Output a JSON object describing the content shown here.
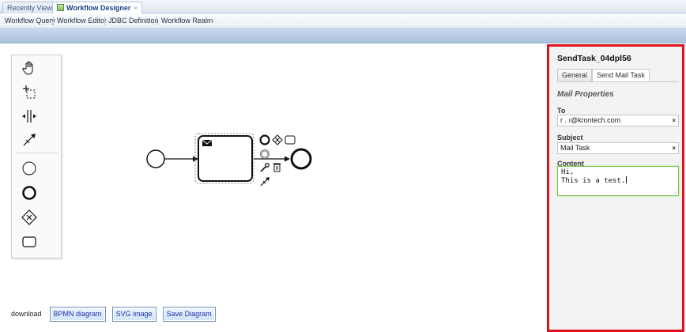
{
  "tabs": [
    {
      "label": "Recently View",
      "active": false
    },
    {
      "label": "Workflow Designer",
      "active": true,
      "close": "×"
    }
  ],
  "menu": [
    "Workflow Query",
    "Workflow Editor",
    "JDBC Definition",
    "Workflow Realm"
  ],
  "palette": {
    "tools": [
      "hand-tool",
      "lasso-tool",
      "space-tool",
      "global-connect-tool",
      "start-event",
      "end-event",
      "gateway",
      "task"
    ]
  },
  "diagram": {
    "elements": [
      "start-event",
      "send-task",
      "end-event"
    ],
    "context_pad": [
      "end-event",
      "gateway",
      "task",
      "intermediate-event",
      "wrench",
      "delete",
      "connect"
    ]
  },
  "download": {
    "label": "download",
    "buttons": [
      "BPMN diagram",
      "SVG image",
      "Save Diagram"
    ]
  },
  "properties": {
    "title": "SendTask_04dpl56",
    "tabs": [
      {
        "label": "General",
        "active": false
      },
      {
        "label": "Send Mail Task",
        "active": true
      }
    ],
    "group": "Mail Properties",
    "fields": {
      "to": {
        "label": "To",
        "value": "r          .            ı@krontech.com",
        "clear": "×"
      },
      "subject": {
        "label": "Subject",
        "value": "Mail Task",
        "clear": "×"
      },
      "content": {
        "label": "Content",
        "lines": [
          "Hi,",
          "This is a test."
        ]
      }
    },
    "border_color": "#e1101c"
  }
}
